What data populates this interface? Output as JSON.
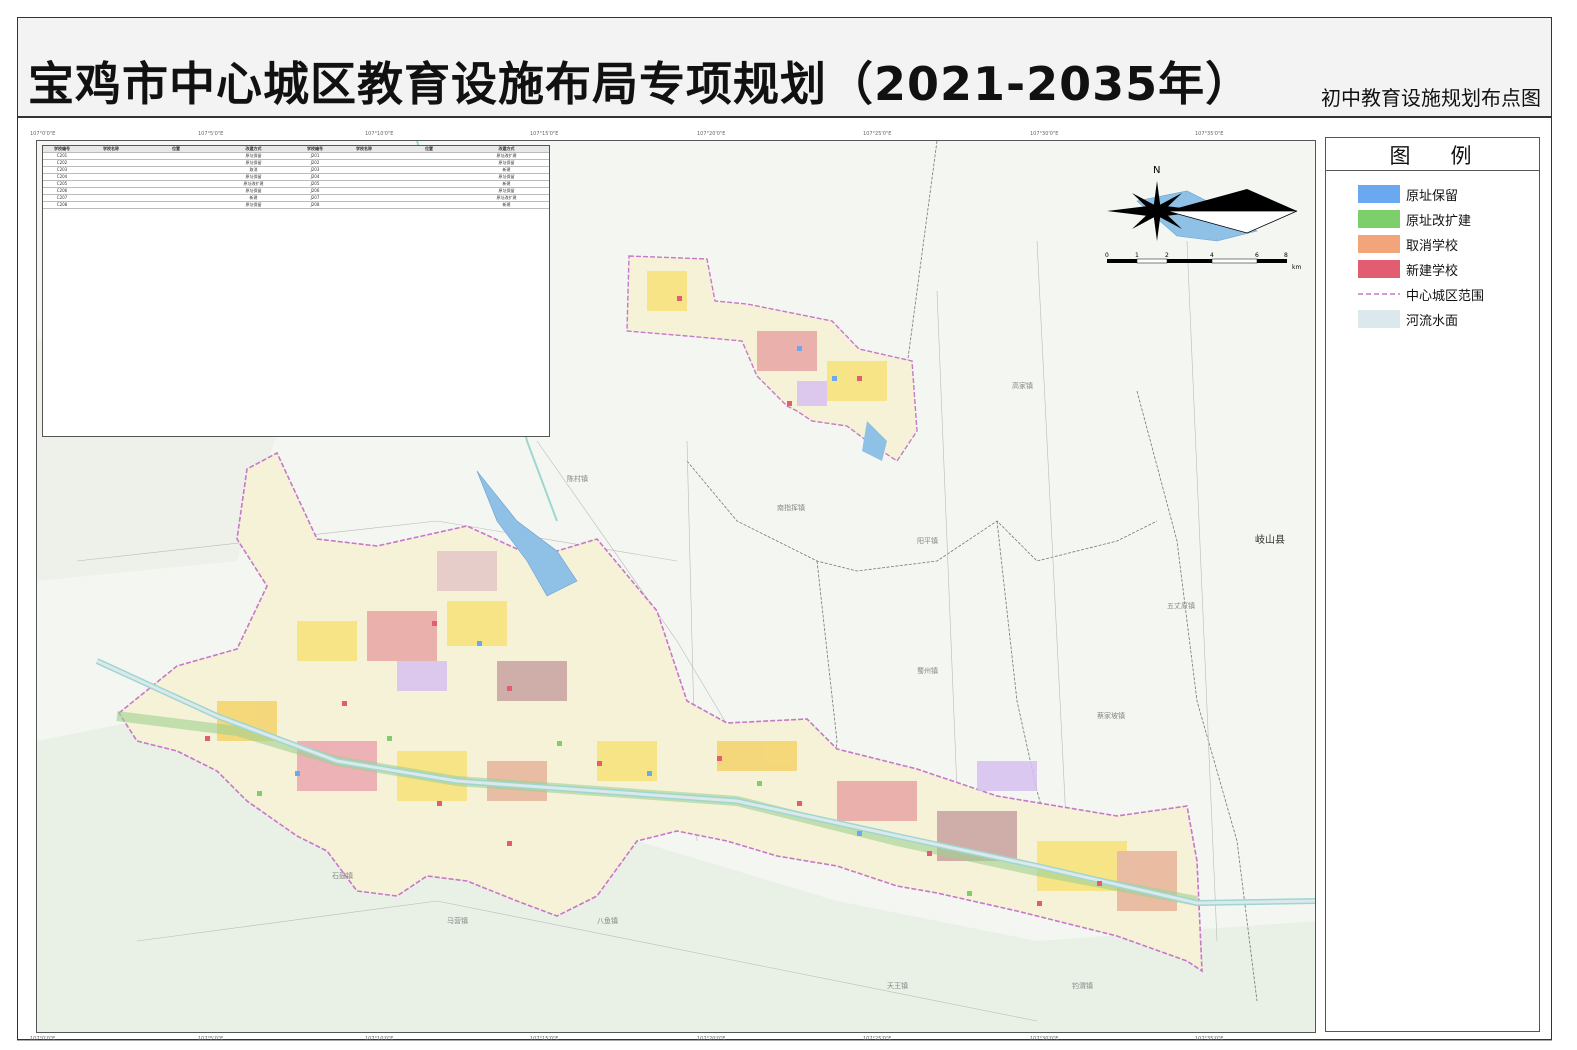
{
  "header": {
    "title": "宝鸡市中心城区教育设施布局专项规划（2021-2035年）",
    "subtitle": "初中教育设施规划布点图"
  },
  "legend": {
    "title": "图例",
    "items": [
      {
        "label": "原址保留",
        "color": "#6aa9f0"
      },
      {
        "label": "原址改扩建",
        "color": "#7ccf6a"
      },
      {
        "label": "取消学校",
        "color": "#f2a57a"
      },
      {
        "label": "新建学校",
        "color": "#e35d72"
      },
      {
        "label": "中心城区范围",
        "color": "#c878c8"
      },
      {
        "label": "河流水面",
        "color": "#dce9ec"
      }
    ]
  },
  "map": {
    "north_label": "N",
    "scale_labels": [
      "0",
      "1",
      "2",
      "4",
      "6",
      "8"
    ],
    "scale_unit": "km",
    "county_label": "岐山县",
    "town_labels": [
      "陈村镇",
      "南指挥镇",
      "蔡家坡镇",
      "五丈原镇",
      "八鱼镇",
      "天王镇",
      "马营镇",
      "石鼓镇",
      "钓渭镇",
      "阳平镇",
      "蜀州镇",
      "高家镇"
    ],
    "top_coords": [
      "107°0'0\"E",
      "107°5'0\"E",
      "107°10'0\"E",
      "107°15'0\"E",
      "107°20'0\"E",
      "107°25'0\"E",
      "107°30'0\"E",
      "107°35'0\"E"
    ],
    "bottom_coords": [
      "107°0'0\"E",
      "107°5'0\"E",
      "107°10'0\"E",
      "107°15'0\"E",
      "107°20'0\"E",
      "107°25'0\"E",
      "107°30'0\"E",
      "107°35'0\"E"
    ]
  },
  "school_table": {
    "headers": [
      "学校编号",
      "学校名称",
      "位置",
      "改建方式",
      "学校编号",
      "学校名称",
      "位置",
      "改建方式"
    ],
    "rows": [
      [
        "C201",
        "",
        "",
        "原址保留",
        "J201",
        "",
        "",
        "原址改扩建"
      ],
      [
        "C202",
        "",
        "",
        "原址保留",
        "J202",
        "",
        "",
        "原址保留"
      ],
      [
        "C203",
        "",
        "",
        "取消",
        "J203",
        "",
        "",
        "新建"
      ],
      [
        "C204",
        "",
        "",
        "原址保留",
        "J204",
        "",
        "",
        "原址保留"
      ],
      [
        "C205",
        "",
        "",
        "原址改扩建",
        "J205",
        "",
        "",
        "新建"
      ],
      [
        "C206",
        "",
        "",
        "原址保留",
        "J206",
        "",
        "",
        "原址保留"
      ],
      [
        "C207",
        "",
        "",
        "新建",
        "J207",
        "",
        "",
        "原址改扩建"
      ],
      [
        "C208",
        "",
        "",
        "原址保留",
        "J208",
        "",
        "",
        "新建"
      ]
    ]
  }
}
